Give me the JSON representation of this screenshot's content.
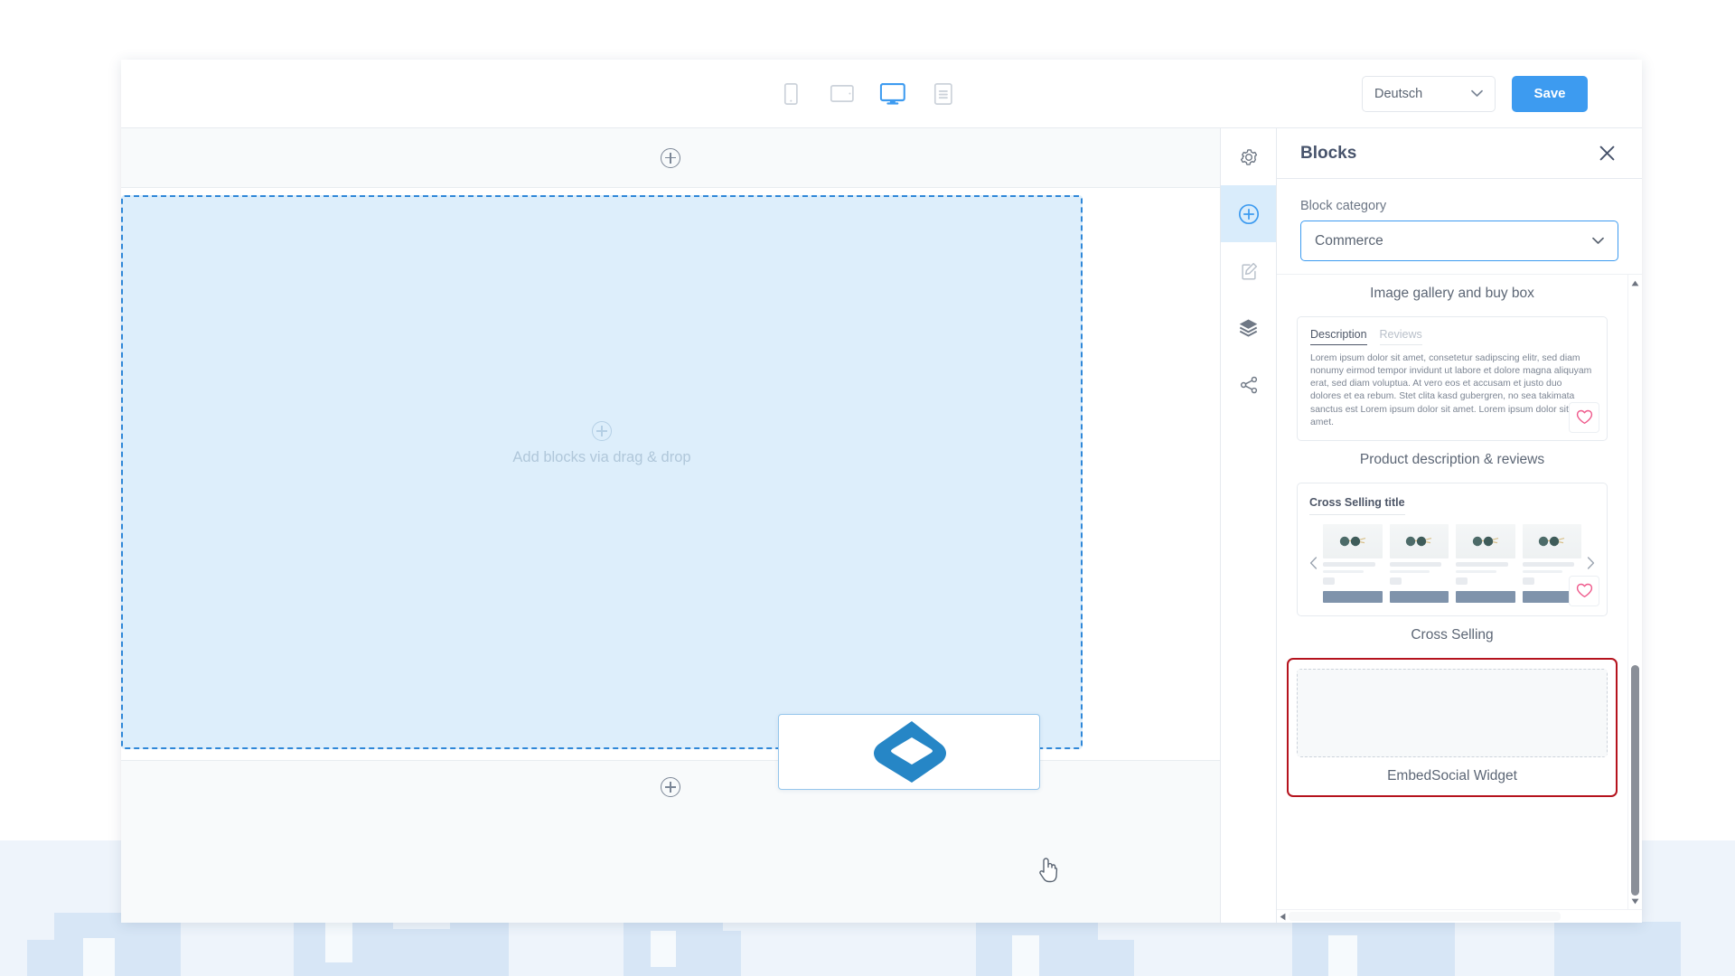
{
  "toolbar": {
    "devices": [
      {
        "name": "mobile",
        "icon": "mobile-icon",
        "active": false
      },
      {
        "name": "tablet",
        "icon": "tablet-icon",
        "active": false
      },
      {
        "name": "desktop",
        "icon": "desktop-icon",
        "active": true
      },
      {
        "name": "content",
        "icon": "content-list-icon",
        "active": false
      }
    ],
    "language_value": "Deutsch",
    "save_label": "Save",
    "accent_color": "#3d9bf0"
  },
  "canvas": {
    "add_section_top_icon": "plus-circle-icon",
    "add_section_bottom_icon": "plus-circle-icon",
    "dropzone": {
      "hint_icon": "plus-circle-icon",
      "hint_label": "Add blocks via drag & drop",
      "fill_color": "#ddeefb",
      "border_color": "#2f87d8"
    },
    "drag_ghost": {
      "icon": "embedsocial-logo-icon",
      "logo_color": "#2686c6"
    },
    "cursor": "hand-pointer-cursor"
  },
  "rail": {
    "items": [
      {
        "name": "settings",
        "icon": "gear-icon",
        "active": false
      },
      {
        "name": "add-blocks",
        "icon": "plus-circle-outline-icon",
        "active": true
      },
      {
        "name": "edit-content",
        "icon": "edit-document-icon",
        "active": false
      },
      {
        "name": "layers",
        "icon": "layers-icon",
        "active": false
      },
      {
        "name": "share",
        "icon": "share-network-icon",
        "active": false
      }
    ]
  },
  "panel": {
    "title": "Blocks",
    "close_icon": "close-icon",
    "category_label": "Block category",
    "category_value": "Commerce",
    "chevron_icon": "chevron-down-icon",
    "blocks": [
      {
        "id": "image-gallery-buy-box",
        "caption": "Image gallery and buy box",
        "preview_type": "caption-only",
        "highlighted": false
      },
      {
        "id": "product-description-reviews",
        "caption": "Product description & reviews",
        "preview_type": "description-tabs",
        "highlighted": false,
        "tabs": [
          {
            "label": "Description",
            "active": true
          },
          {
            "label": "Reviews",
            "active": false
          }
        ],
        "body_text": "Lorem ipsum dolor sit amet, consetetur sadipscing elitr, sed diam nonumy eirmod tempor invidunt ut labore et dolore magna aliquyam erat, sed diam voluptua. At vero eos et accusam et justo duo dolores et ea rebum. Stet clita kasd gubergren, no sea takimata sanctus est Lorem ipsum dolor sit amet. Lorem ipsum dolor sit amet.",
        "favorite_icon": "heart-icon",
        "favorite_color": "#ef5a8c"
      },
      {
        "id": "cross-selling",
        "caption": "Cross Selling",
        "preview_type": "carousel",
        "highlighted": false,
        "carousel_title": "Cross Selling title",
        "prev_icon": "chevron-left-icon",
        "next_icon": "chevron-right-icon",
        "card_count": 4,
        "favorite_icon": "heart-icon",
        "favorite_color": "#ef5a8c"
      },
      {
        "id": "embedsocial-widget",
        "caption": "EmbedSocial Widget",
        "preview_type": "empty-placeholder",
        "highlighted": true,
        "highlight_color": "#b5131d"
      }
    ],
    "vscroll": {
      "up_icon": "triangle-up-icon",
      "down_icon": "triangle-down-icon"
    },
    "hscroll": {
      "left_icon": "triangle-left-icon"
    }
  }
}
